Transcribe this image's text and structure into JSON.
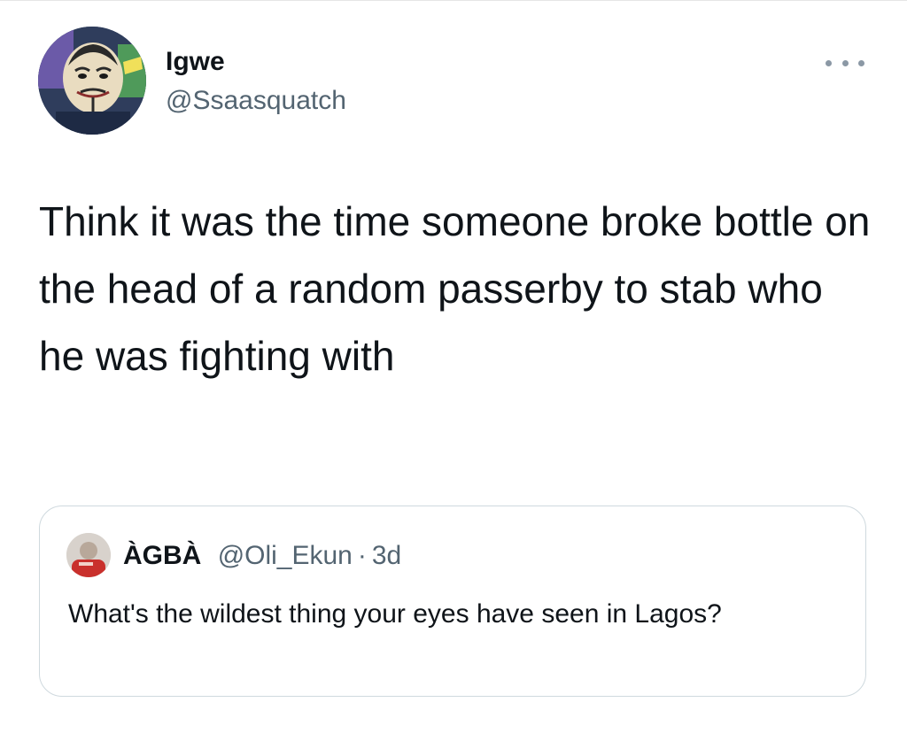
{
  "tweet": {
    "author": {
      "display_name": "Igwe",
      "handle": "@Ssaasquatch",
      "avatar_icon": "guy-fawkes-mask-avatar"
    },
    "more_icon": "more-horizontal-icon",
    "text": "Think it was the time someone broke bottle on the head of a random passerby to stab who he was fighting with"
  },
  "quoted_tweet": {
    "author": {
      "display_name": "ÀGBÀ",
      "handle": "@Oli_Ekun",
      "separator": "·",
      "time": "3d",
      "avatar_icon": "user-avatar"
    },
    "text": "What's the wildest thing your eyes have seen in Lagos?"
  },
  "colors": {
    "primary_text": "#0f1419",
    "secondary_text": "#536471",
    "card_border": "#cfd9de",
    "background": "#ffffff"
  }
}
